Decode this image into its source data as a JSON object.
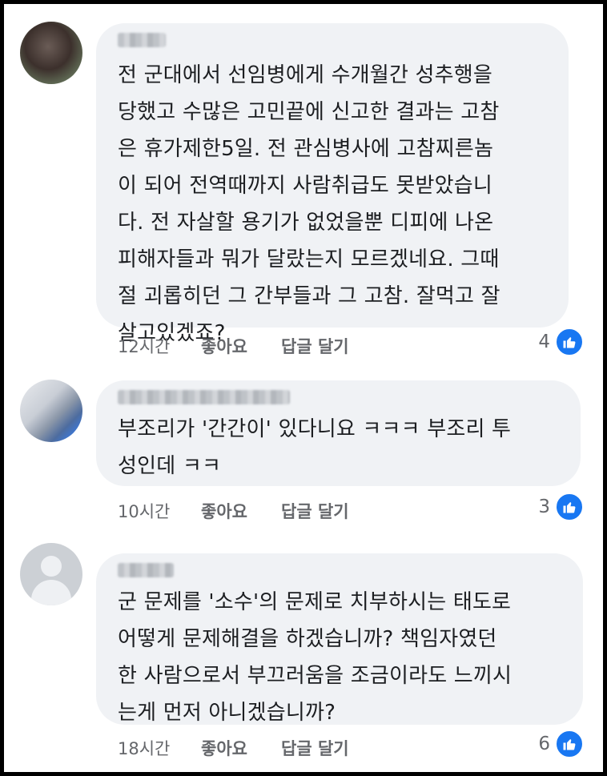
{
  "comments": [
    {
      "text": "전 군대에서 선임병에게 수개월간 성추행을\n당했고 수많은 고민끝에 신고한 결과는 고참\n은 휴가제한5일. 전 관심병사에 고참찌른놈\n이 되어 전역때까지 사람취급도 못받았습니\n다. 전 자살할 용기가 없었을뿐 디피에 나온\n피해자들과 뭐가 달랐는지 모르겠네요. 그때\n절 괴롭히던 그 간부들과 그 고참. 잘먹고 잘\n살고있겠죠?",
      "time": "12시간",
      "like_label": "좋아요",
      "reply_label": "답글 달기",
      "reaction_count": "4"
    },
    {
      "text": "부조리가 '간간이' 있다니요 ㅋㅋㅋ 부조리 투\n성인데 ㅋㅋ",
      "time": "10시간",
      "like_label": "좋아요",
      "reply_label": "답글 달기",
      "reaction_count": "3"
    },
    {
      "text": "군 문제를 '소수'의 문제로 치부하시는 태도로\n어떻게 문제해결을 하겠습니까? 책임자였던\n한 사람으로서 부끄러움을 조금이라도 느끼시\n는게 먼저 아니겠습니까?",
      "time": "18시간",
      "like_label": "좋아요",
      "reply_label": "답글 달기",
      "reaction_count": "6"
    }
  ],
  "colors": {
    "bubble": "#f0f2f5",
    "text": "#1c1e21",
    "meta": "#65676b",
    "like_blue": "#1877f2"
  },
  "icons": {
    "reaction": "thumbs-up-icon"
  }
}
